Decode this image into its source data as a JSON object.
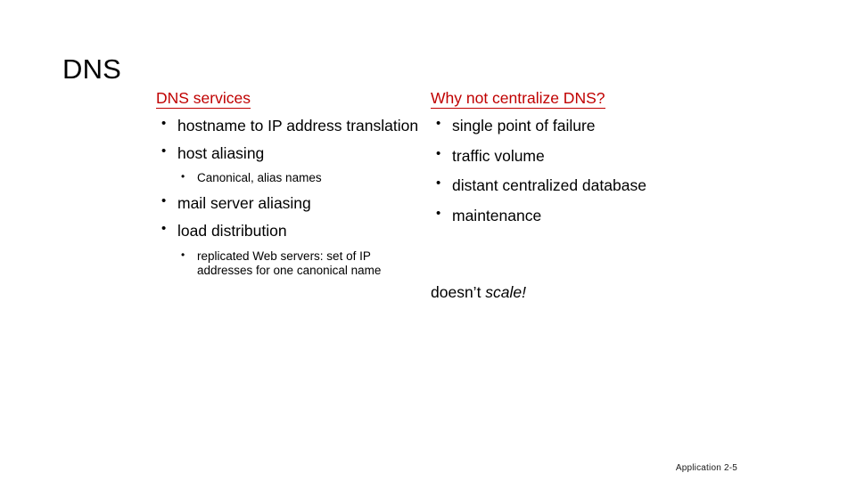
{
  "slide": {
    "title": "DNS",
    "footer": "Application  2-5",
    "accent_color": "#C00000",
    "text_color": "#000000",
    "background_color": "#FFFFFF"
  },
  "left_column": {
    "heading": "DNS services",
    "bullets": [
      {
        "text": "hostname to IP address translation"
      },
      {
        "text": "host aliasing"
      },
      {
        "text": "mail server aliasing"
      },
      {
        "text": "load distribution"
      }
    ],
    "sub_bullets_after_host_aliasing": [
      "Canonical, alias names"
    ],
    "sub_bullets_after_load_distribution": [
      "replicated Web servers: set of IP addresses for one canonical name"
    ]
  },
  "right_column": {
    "heading": "Why not centralize DNS?",
    "bullets": [
      {
        "text": "single point of failure"
      },
      {
        "text": "traffic volume"
      },
      {
        "text": "distant centralized database"
      },
      {
        "text": "maintenance"
      }
    ],
    "note_plain": "doesn’t ",
    "note_italic": "scale!"
  }
}
